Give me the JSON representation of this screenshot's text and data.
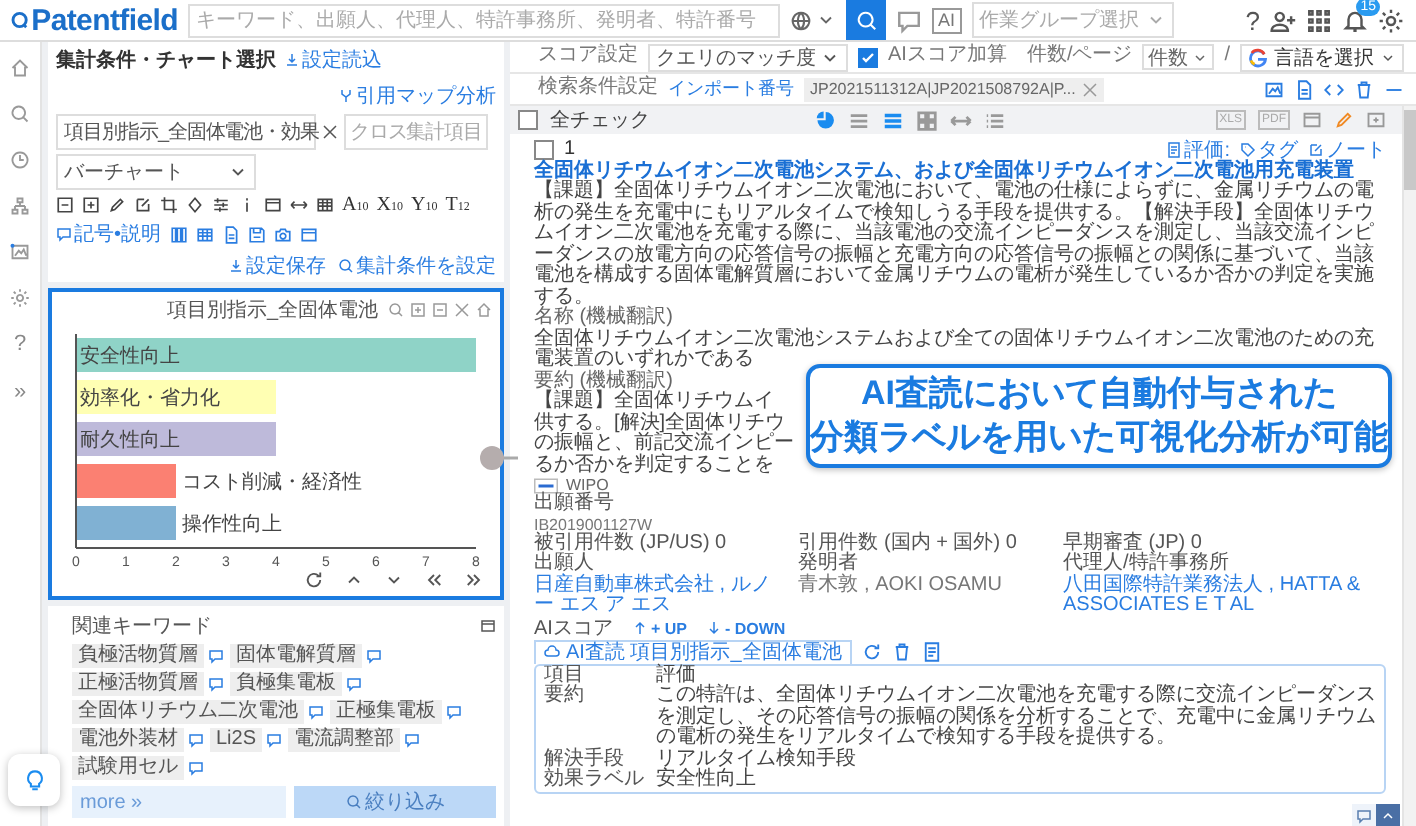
{
  "header": {
    "logo": "Patentfield",
    "search_placeholder": "キーワード、出願人、代理人、特許事務所、発明者、特許番号",
    "ai_button": "AI",
    "group_placeholder": "作業グループ選択",
    "help": "?",
    "notification_count": "15"
  },
  "rail": {
    "help": "?",
    "expand": "»"
  },
  "left_panel": {
    "title": "集計条件・チャート選択",
    "load": "設定読込",
    "citation_map": "引用マップ分析",
    "item_field": "項目別指示_全固体電池・効果",
    "cross_placeholder": "クロス集計項目",
    "chart_type": "バーチャート",
    "size_labels": [
      {
        "letter": "A",
        "size": "10"
      },
      {
        "letter": "X",
        "size": "10"
      },
      {
        "letter": "Y",
        "size": "10"
      },
      {
        "letter": "T",
        "size": "12"
      }
    ],
    "legend": "記号•説明",
    "save": "設定保存",
    "set_condition": "集計条件を設定"
  },
  "chart_panel": {
    "title": "項目別指示_全固体電池",
    "chart_data": {
      "type": "bar",
      "orientation": "horizontal",
      "categories": [
        "安全性向上",
        "効率化・省力化",
        "耐久性向上",
        "コスト削減・経済性",
        "操作性向上"
      ],
      "values": [
        8,
        4,
        4,
        2,
        2
      ],
      "colors": [
        "#8fd3c7",
        "#ffffb3",
        "#bebada",
        "#fb8072",
        "#80b1d3"
      ],
      "xlim": [
        0,
        8
      ],
      "xticks": [
        0,
        1,
        2,
        3,
        4,
        5,
        6,
        7,
        8
      ]
    }
  },
  "keywords": {
    "title": "関連キーワード",
    "tags": [
      "負極活物質層",
      "固体電解質層",
      "正極活物質層",
      "負極集電板",
      "全固体リチウム二次電池",
      "正極集電板",
      "電池外装材",
      "Li2S",
      "電流調整部",
      "試験用セル"
    ],
    "more": "more »",
    "filter": "絞り込み"
  },
  "results_bar": {
    "score_label": "スコア設定",
    "score_select": "クエリのマッチ度",
    "ai_score": {
      "label": "AIスコア加算",
      "checked": true
    },
    "per_page_label": "件数/ページ",
    "per_page": "件数",
    "separator": "/",
    "translate": "言語を選択",
    "condition_label": "検索条件設定",
    "import_label": "インポート番号",
    "import_value": "JP2021511312A|JP2021508792A|P...",
    "check_all": {
      "label": "全チェック",
      "checked": false
    },
    "view_modes": [
      {
        "kind": "lines",
        "selected": false
      },
      {
        "kind": "bold-lines",
        "selected": true
      },
      {
        "kind": "grid",
        "selected": false
      },
      {
        "kind": "arrows",
        "selected": false
      },
      {
        "kind": "bullets",
        "selected": false
      }
    ],
    "export_labels": [
      "XLS",
      "PDF"
    ]
  },
  "result": {
    "index": "1",
    "checked": false,
    "rating": "評価:",
    "tag": "タグ",
    "note": "ノート",
    "title": "全固体リチウムイオン二次電池システム、および全固体リチウムイオン二次電池用充電装置",
    "abstract": "【課題】全固体リチウムイオン二次電池において、電池の仕様によらずに、金属リチウムの電析の発生を充電中にもリアルタイムで検知しうる手段を提供する。【解決手段】全固体リチウムイオン二次電池を充電する際に、当該電池の交流インピーダンスを測定し、当該交流インピーダンスの放電方向の応答信号の振幅と充電方向の応答信号の振幅との関係に基づいて、当該電池を構成する固体電解質層において金属リチウムの電析が発生しているか否かの判定を実施する。",
    "name_label": "名称 (機械翻訳)",
    "name_text": "全固体リチウムイオン二次電池システムおよび全ての固体リチウムイオン二次電池のための充電装置のいずれかである",
    "summary_label": "要約 (機械翻訳)",
    "summary_lines": [
      "【課題】全固体リチウムイ",
      "供する。[解決]全固体リチウ",
      "の振幅と、前記交流インピー",
      "るか否かを判定することを"
    ],
    "office": "WIPO",
    "app_no_label": "出願番号",
    "app_no": "IB2019001127W",
    "counts": [
      {
        "label": "被引用件数 (JP/US)",
        "value": "0"
      },
      {
        "label": "引用件数 (国内 + 国外)",
        "value": "0"
      },
      {
        "label": "早期審査 (JP)",
        "value": "0"
      }
    ],
    "parties": [
      {
        "label": "出願人",
        "value": "日産自動車株式会社 , ルノー エス ア エス",
        "link": true
      },
      {
        "label": "発明者",
        "value": "青木敦 , AOKI OSAMU",
        "link": false
      },
      {
        "label": "代理人/特許事務所",
        "value": "八田国際特許業務法人 , HATTA & ASSOCIATES E T AL",
        "link": true
      }
    ],
    "ai_score_label": "AIスコア",
    "up": "+ UP",
    "down": "- DOWN",
    "ai_tab": "AI査読 項目別指示_全固体電池",
    "table": {
      "columns": [
        "項目",
        "評価"
      ],
      "rows": [
        [
          "要約",
          "この特許は、全固体リチウムイオン二次電池を充電する際に交流インピーダンスを測定し、その応答信号の振幅の関係を分析することで、充電中に金属リチウムの電析の発生をリアルタイムで検知する手段を提供する。"
        ],
        [
          "解決手段",
          "リアルタイム検知手段"
        ],
        [
          "効果ラベル",
          "安全性向上"
        ]
      ]
    }
  },
  "callout": {
    "lines": [
      "AI査読において自動付与された",
      "分類ラベルを用いた可視化分析が可能"
    ]
  }
}
